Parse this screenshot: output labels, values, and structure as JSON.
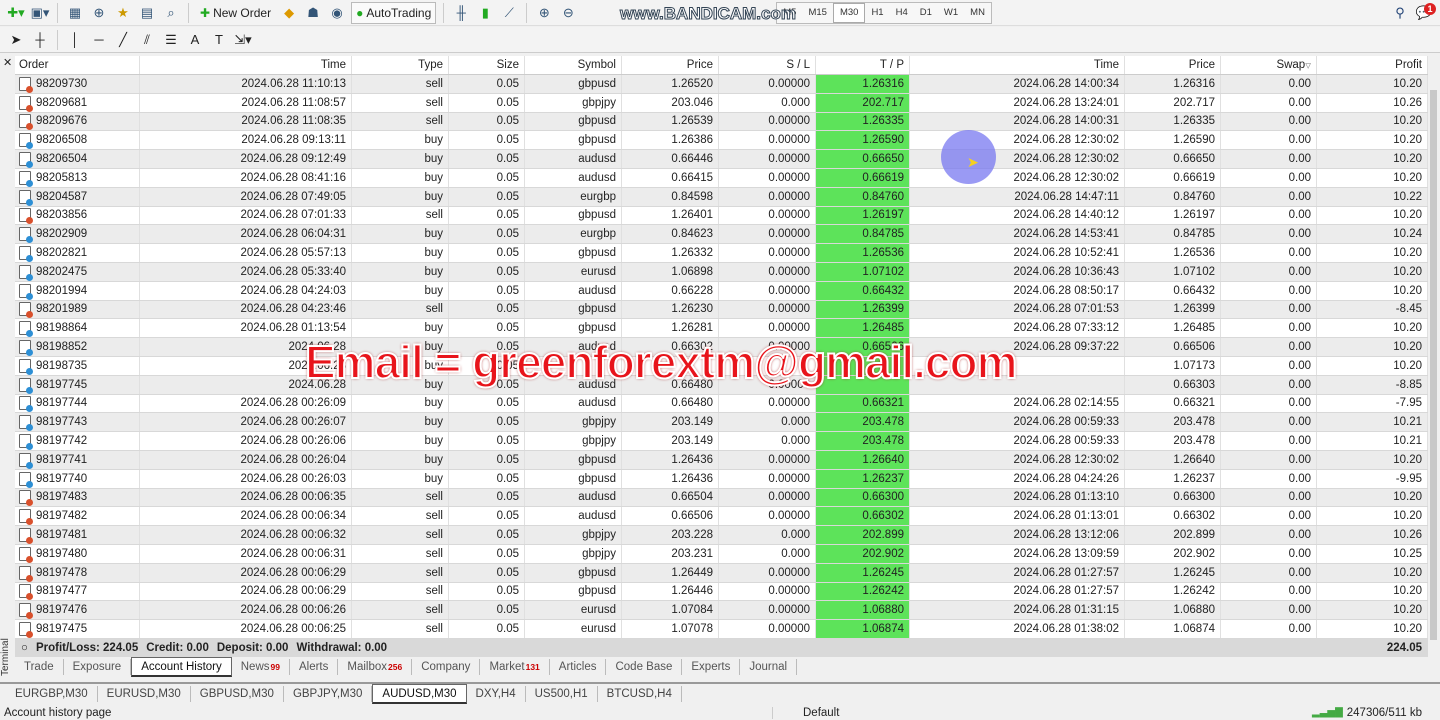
{
  "toolbar": {
    "new_order": "New Order",
    "autotrading": "AutoTrading",
    "timeframes": [
      "M5",
      "M15",
      "M30",
      "H1",
      "H4",
      "D1",
      "W1",
      "MN"
    ],
    "active_timeframe": "M30",
    "notification_count": "1",
    "watermark": "www.BANDICAM.com"
  },
  "table": {
    "columns": [
      "Order",
      "Time",
      "Type",
      "Size",
      "Symbol",
      "Price",
      "S / L",
      "T / P",
      "Time",
      "Price",
      "Swap",
      "Profit"
    ],
    "rows": [
      [
        "98209730",
        "2024.06.28 11:10:13",
        "sell",
        "0.05",
        "gbpusd",
        "1.26520",
        "0.00000",
        "1.26316",
        "2024.06.28 14:00:34",
        "1.26316",
        "0.00",
        "10.20"
      ],
      [
        "98209681",
        "2024.06.28 11:08:57",
        "sell",
        "0.05",
        "gbpjpy",
        "203.046",
        "0.000",
        "202.717",
        "2024.06.28 13:24:01",
        "202.717",
        "0.00",
        "10.26"
      ],
      [
        "98209676",
        "2024.06.28 11:08:35",
        "sell",
        "0.05",
        "gbpusd",
        "1.26539",
        "0.00000",
        "1.26335",
        "2024.06.28 14:00:31",
        "1.26335",
        "0.00",
        "10.20"
      ],
      [
        "98206508",
        "2024.06.28 09:13:11",
        "buy",
        "0.05",
        "gbpusd",
        "1.26386",
        "0.00000",
        "1.26590",
        "2024.06.28 12:30:02",
        "1.26590",
        "0.00",
        "10.20"
      ],
      [
        "98206504",
        "2024.06.28 09:12:49",
        "buy",
        "0.05",
        "audusd",
        "0.66446",
        "0.00000",
        "0.66650",
        "2024.06.28 12:30:02",
        "0.66650",
        "0.00",
        "10.20"
      ],
      [
        "98205813",
        "2024.06.28 08:41:16",
        "buy",
        "0.05",
        "audusd",
        "0.66415",
        "0.00000",
        "0.66619",
        "2024.06.28 12:30:02",
        "0.66619",
        "0.00",
        "10.20"
      ],
      [
        "98204587",
        "2024.06.28 07:49:05",
        "buy",
        "0.05",
        "eurgbp",
        "0.84598",
        "0.00000",
        "0.84760",
        "2024.06.28 14:47:11",
        "0.84760",
        "0.00",
        "10.22"
      ],
      [
        "98203856",
        "2024.06.28 07:01:33",
        "sell",
        "0.05",
        "gbpusd",
        "1.26401",
        "0.00000",
        "1.26197",
        "2024.06.28 14:40:12",
        "1.26197",
        "0.00",
        "10.20"
      ],
      [
        "98202909",
        "2024.06.28 06:04:31",
        "buy",
        "0.05",
        "eurgbp",
        "0.84623",
        "0.00000",
        "0.84785",
        "2024.06.28 14:53:41",
        "0.84785",
        "0.00",
        "10.24"
      ],
      [
        "98202821",
        "2024.06.28 05:57:13",
        "buy",
        "0.05",
        "gbpusd",
        "1.26332",
        "0.00000",
        "1.26536",
        "2024.06.28 10:52:41",
        "1.26536",
        "0.00",
        "10.20"
      ],
      [
        "98202475",
        "2024.06.28 05:33:40",
        "buy",
        "0.05",
        "eurusd",
        "1.06898",
        "0.00000",
        "1.07102",
        "2024.06.28 10:36:43",
        "1.07102",
        "0.00",
        "10.20"
      ],
      [
        "98201994",
        "2024.06.28 04:24:03",
        "buy",
        "0.05",
        "audusd",
        "0.66228",
        "0.00000",
        "0.66432",
        "2024.06.28 08:50:17",
        "0.66432",
        "0.00",
        "10.20"
      ],
      [
        "98201989",
        "2024.06.28 04:23:46",
        "sell",
        "0.05",
        "gbpusd",
        "1.26230",
        "0.00000",
        "1.26399",
        "2024.06.28 07:01:53",
        "1.26399",
        "0.00",
        "-8.45"
      ],
      [
        "98198864",
        "2024.06.28 01:13:54",
        "buy",
        "0.05",
        "gbpusd",
        "1.26281",
        "0.00000",
        "1.26485",
        "2024.06.28 07:33:12",
        "1.26485",
        "0.00",
        "10.20"
      ],
      [
        "98198852",
        "2024.06.28",
        "buy",
        "0.05",
        "audusd",
        "0.66302",
        "0.00000",
        "0.66506",
        "2024.06.28 09:37:22",
        "0.66506",
        "0.00",
        "10.20"
      ],
      [
        "98198735",
        "2024.06.28",
        "buy",
        "0.05",
        "",
        "",
        "",
        "",
        "",
        "1.07173",
        "0.00",
        "10.20"
      ],
      [
        "98197745",
        "2024.06.28",
        "buy",
        "0.05",
        "audusd",
        "0.66480",
        "0.00000",
        "",
        "",
        "0.66303",
        "0.00",
        "-8.85"
      ],
      [
        "98197744",
        "2024.06.28 00:26:09",
        "buy",
        "0.05",
        "audusd",
        "0.66480",
        "0.00000",
        "0.66321",
        "2024.06.28 02:14:55",
        "0.66321",
        "0.00",
        "-7.95"
      ],
      [
        "98197743",
        "2024.06.28 00:26:07",
        "buy",
        "0.05",
        "gbpjpy",
        "203.149",
        "0.000",
        "203.478",
        "2024.06.28 00:59:33",
        "203.478",
        "0.00",
        "10.21"
      ],
      [
        "98197742",
        "2024.06.28 00:26:06",
        "buy",
        "0.05",
        "gbpjpy",
        "203.149",
        "0.000",
        "203.478",
        "2024.06.28 00:59:33",
        "203.478",
        "0.00",
        "10.21"
      ],
      [
        "98197741",
        "2024.06.28 00:26:04",
        "buy",
        "0.05",
        "gbpusd",
        "1.26436",
        "0.00000",
        "1.26640",
        "2024.06.28 12:30:02",
        "1.26640",
        "0.00",
        "10.20"
      ],
      [
        "98197740",
        "2024.06.28 00:26:03",
        "buy",
        "0.05",
        "gbpusd",
        "1.26436",
        "0.00000",
        "1.26237",
        "2024.06.28 04:24:26",
        "1.26237",
        "0.00",
        "-9.95"
      ],
      [
        "98197483",
        "2024.06.28 00:06:35",
        "sell",
        "0.05",
        "audusd",
        "0.66504",
        "0.00000",
        "0.66300",
        "2024.06.28 01:13:10",
        "0.66300",
        "0.00",
        "10.20"
      ],
      [
        "98197482",
        "2024.06.28 00:06:34",
        "sell",
        "0.05",
        "audusd",
        "0.66506",
        "0.00000",
        "0.66302",
        "2024.06.28 01:13:01",
        "0.66302",
        "0.00",
        "10.20"
      ],
      [
        "98197481",
        "2024.06.28 00:06:32",
        "sell",
        "0.05",
        "gbpjpy",
        "203.228",
        "0.000",
        "202.899",
        "2024.06.28 13:12:06",
        "202.899",
        "0.00",
        "10.26"
      ],
      [
        "98197480",
        "2024.06.28 00:06:31",
        "sell",
        "0.05",
        "gbpjpy",
        "203.231",
        "0.000",
        "202.902",
        "2024.06.28 13:09:59",
        "202.902",
        "0.00",
        "10.25"
      ],
      [
        "98197478",
        "2024.06.28 00:06:29",
        "sell",
        "0.05",
        "gbpusd",
        "1.26449",
        "0.00000",
        "1.26245",
        "2024.06.28 01:27:57",
        "1.26245",
        "0.00",
        "10.20"
      ],
      [
        "98197477",
        "2024.06.28 00:06:29",
        "sell",
        "0.05",
        "gbpusd",
        "1.26446",
        "0.00000",
        "1.26242",
        "2024.06.28 01:27:57",
        "1.26242",
        "0.00",
        "10.20"
      ],
      [
        "98197476",
        "2024.06.28 00:06:26",
        "sell",
        "0.05",
        "eurusd",
        "1.07084",
        "0.00000",
        "1.06880",
        "2024.06.28 01:31:15",
        "1.06880",
        "0.00",
        "10.20"
      ],
      [
        "98197475",
        "2024.06.28 00:06:25",
        "sell",
        "0.05",
        "eurusd",
        "1.07078",
        "0.00000",
        "1.06874",
        "2024.06.28 01:38:02",
        "1.06874",
        "0.00",
        "10.20"
      ]
    ]
  },
  "summary": {
    "profit_loss": "Profit/Loss: 224.05",
    "credit": "Credit: 0.00",
    "deposit": "Deposit: 0.00",
    "withdrawal": "Withdrawal: 0.00",
    "total": "224.05"
  },
  "terminal_label": "Terminal",
  "tabs": [
    {
      "label": "Trade"
    },
    {
      "label": "Exposure"
    },
    {
      "label": "Account History",
      "active": true
    },
    {
      "label": "News",
      "badge": "99"
    },
    {
      "label": "Alerts"
    },
    {
      "label": "Mailbox",
      "badge": "256"
    },
    {
      "label": "Company"
    },
    {
      "label": "Market",
      "badge": "131"
    },
    {
      "label": "Articles"
    },
    {
      "label": "Code Base"
    },
    {
      "label": "Experts"
    },
    {
      "label": "Journal"
    }
  ],
  "chart_tabs": [
    {
      "label": "EURGBP,M30"
    },
    {
      "label": "EURUSD,M30"
    },
    {
      "label": "GBPUSD,M30"
    },
    {
      "label": "GBPJPY,M30"
    },
    {
      "label": "AUDUSD,M30",
      "active": true
    },
    {
      "label": "DXY,H4"
    },
    {
      "label": "US500,H1"
    },
    {
      "label": "BTCUSD,H4"
    }
  ],
  "status": {
    "left": "Account history page",
    "profile": "Default",
    "traffic": "247306/511 kb"
  },
  "overlay_text": "Email = greenforextm@gmail.com",
  "colors": {
    "tp_highlight": "#5de35a",
    "sell_icon": "#d9502c",
    "buy_icon": "#2d8fd5",
    "overlay": "#e8141b"
  }
}
